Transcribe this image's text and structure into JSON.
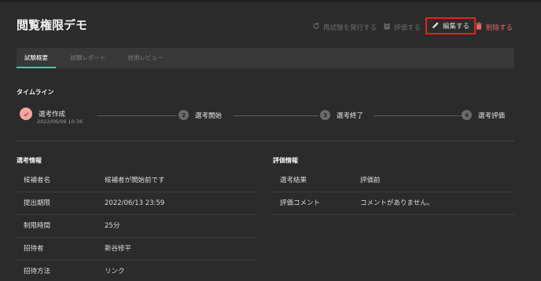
{
  "page": {
    "title": "閲覧権限デモ"
  },
  "actions": {
    "retest": "再試験を発行する",
    "evaluate": "評価する",
    "edit": "編集する",
    "delete": "削除する"
  },
  "tabs": [
    {
      "label": "試験概要",
      "active": true
    },
    {
      "label": "試験レポート",
      "active": false
    },
    {
      "label": "技術レビュー",
      "active": false
    }
  ],
  "timeline": {
    "heading": "タイムライン",
    "steps": [
      {
        "number": "",
        "label": "選考作成",
        "date": "2022/06/06 10:36",
        "done": true
      },
      {
        "number": "2",
        "label": "選考開始"
      },
      {
        "number": "3",
        "label": "選考終了"
      },
      {
        "number": "4",
        "label": "選考評価"
      }
    ]
  },
  "selection_info": {
    "heading": "選考情報",
    "rows": [
      {
        "key": "候補者名",
        "value": "候補者が開始前です"
      },
      {
        "key": "提出期限",
        "value": "2022/06/13 23:59"
      },
      {
        "key": "制限時間",
        "value": "25分"
      },
      {
        "key": "招待者",
        "value": "新谷修平"
      },
      {
        "key": "招待方法",
        "value": "リンク"
      }
    ]
  },
  "evaluation_info": {
    "heading": "評価情報",
    "rows": [
      {
        "key": "選考結果",
        "value": "評価前"
      },
      {
        "key": "評価コメント",
        "value": "コメントがありません。"
      }
    ]
  },
  "colors": {
    "background": "#2b2b2b",
    "accent_tab": "#57c0ad",
    "highlight_box": "#e0251f",
    "delete": "#e06a6a",
    "done_step": "#f1a7a2"
  }
}
